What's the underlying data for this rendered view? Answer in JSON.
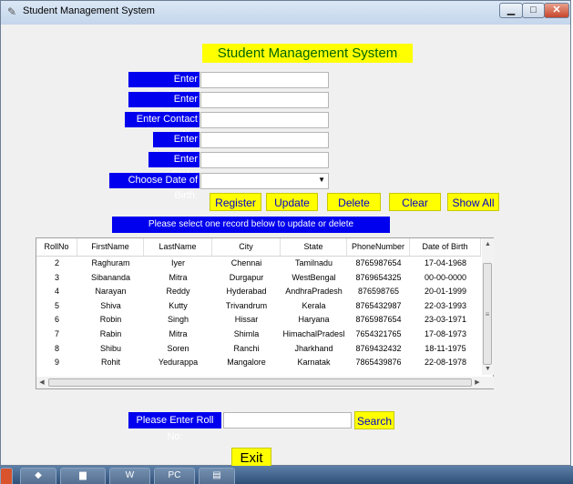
{
  "window": {
    "title": "Student Management System"
  },
  "heading": "Student Management System",
  "form": {
    "first_name_label": "Enter FirstName:",
    "last_name_label": "Enter LastName:",
    "contact_label": "Enter Contact No:",
    "city_label": "Enter City:",
    "state_label": "Enter State:",
    "dob_label": "Choose Date of Birth:"
  },
  "buttons": {
    "register": "Register",
    "update": "Update",
    "delete": "Delete",
    "clear": "Clear",
    "show_all": "Show All"
  },
  "info_text": "Please select one record below to update or delete",
  "table": {
    "columns": [
      "RollNo",
      "FirstName",
      "LastName",
      "City",
      "State",
      "PhoneNumber",
      "Date of Birth"
    ],
    "rows": [
      [
        "2",
        "Raghuram",
        "Iyer",
        "Chennai",
        "Tamilnadu",
        "8765987654",
        "17-04-1968"
      ],
      [
        "3",
        "Sibananda",
        "Mitra",
        "Durgapur",
        "WestBengal",
        "8769654325",
        "00-00-0000"
      ],
      [
        "4",
        "Narayan",
        "Reddy",
        "Hyderabad",
        "AndhraPradesh",
        "876598765",
        "20-01-1999"
      ],
      [
        "5",
        "Shiva",
        "Kutty",
        "Trivandrum",
        "Kerala",
        "8765432987",
        "22-03-1993"
      ],
      [
        "6",
        "Robin",
        "Singh",
        "Hissar",
        "Haryana",
        "8765987654",
        "23-03-1971"
      ],
      [
        "7",
        "Rabin",
        "Mitra",
        "Shimla",
        "HimachalPradesl",
        "7654321765",
        "17-08-1973"
      ],
      [
        "8",
        "Shibu",
        "Soren",
        "Ranchi",
        "Jharkhand",
        "8769432432",
        "18-11-1975"
      ],
      [
        "9",
        "Rohit",
        "Yedurappa",
        "Mangalore",
        "Karnatak",
        "7865439876",
        "22-08-1978"
      ]
    ]
  },
  "search": {
    "label": "Please Enter Roll No:",
    "button": "Search"
  },
  "exit_label": "Exit",
  "taskbar": {
    "items": [
      "vscode-icon",
      "folder-icon",
      "word-icon",
      "pycharm-icon",
      "terminal-icon"
    ],
    "pc_label": "PC"
  }
}
